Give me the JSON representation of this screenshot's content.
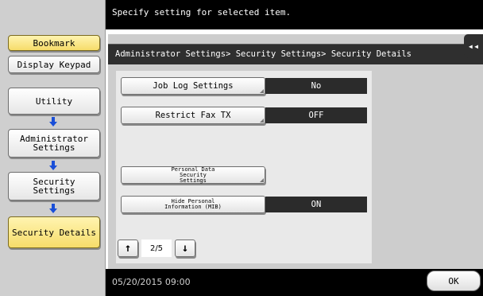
{
  "sidebar": {
    "bookmark_label": "Bookmark",
    "display_keypad_label": "Display Keypad",
    "utility_label": "Utility",
    "admin_settings_line1": "Administrator",
    "admin_settings_line2": "Settings",
    "security_settings_line1": "Security",
    "security_settings_line2": "Settings",
    "security_details_label": "Security Details",
    "arrow_icon": "arrow-down-icon"
  },
  "topbar": {
    "message": "Specify setting for selected item."
  },
  "panel": {
    "breadcrumb": "Administrator Settings> Security Settings> Security Details",
    "back_icon": "double-chevron-left-icon"
  },
  "settings": [
    {
      "label": "Job Log Settings",
      "value": "No"
    },
    {
      "label": "Restrict Fax TX",
      "value": "OFF"
    },
    {
      "label_line1": "Personal Data",
      "label_line2": "Security",
      "label_line3": "Settings"
    },
    {
      "label_line1": "Hide Personal",
      "label_line2": "Information (MIB)",
      "value": "ON"
    }
  ],
  "pager": {
    "page_text": "2/5"
  },
  "footer": {
    "datetime": "05/20/2015  09:00",
    "ok_label": "OK"
  },
  "colors": {
    "accent_active": "#f6dc6a",
    "arrow_blue": "#1a4fd8",
    "dark_bar": "#000000"
  }
}
